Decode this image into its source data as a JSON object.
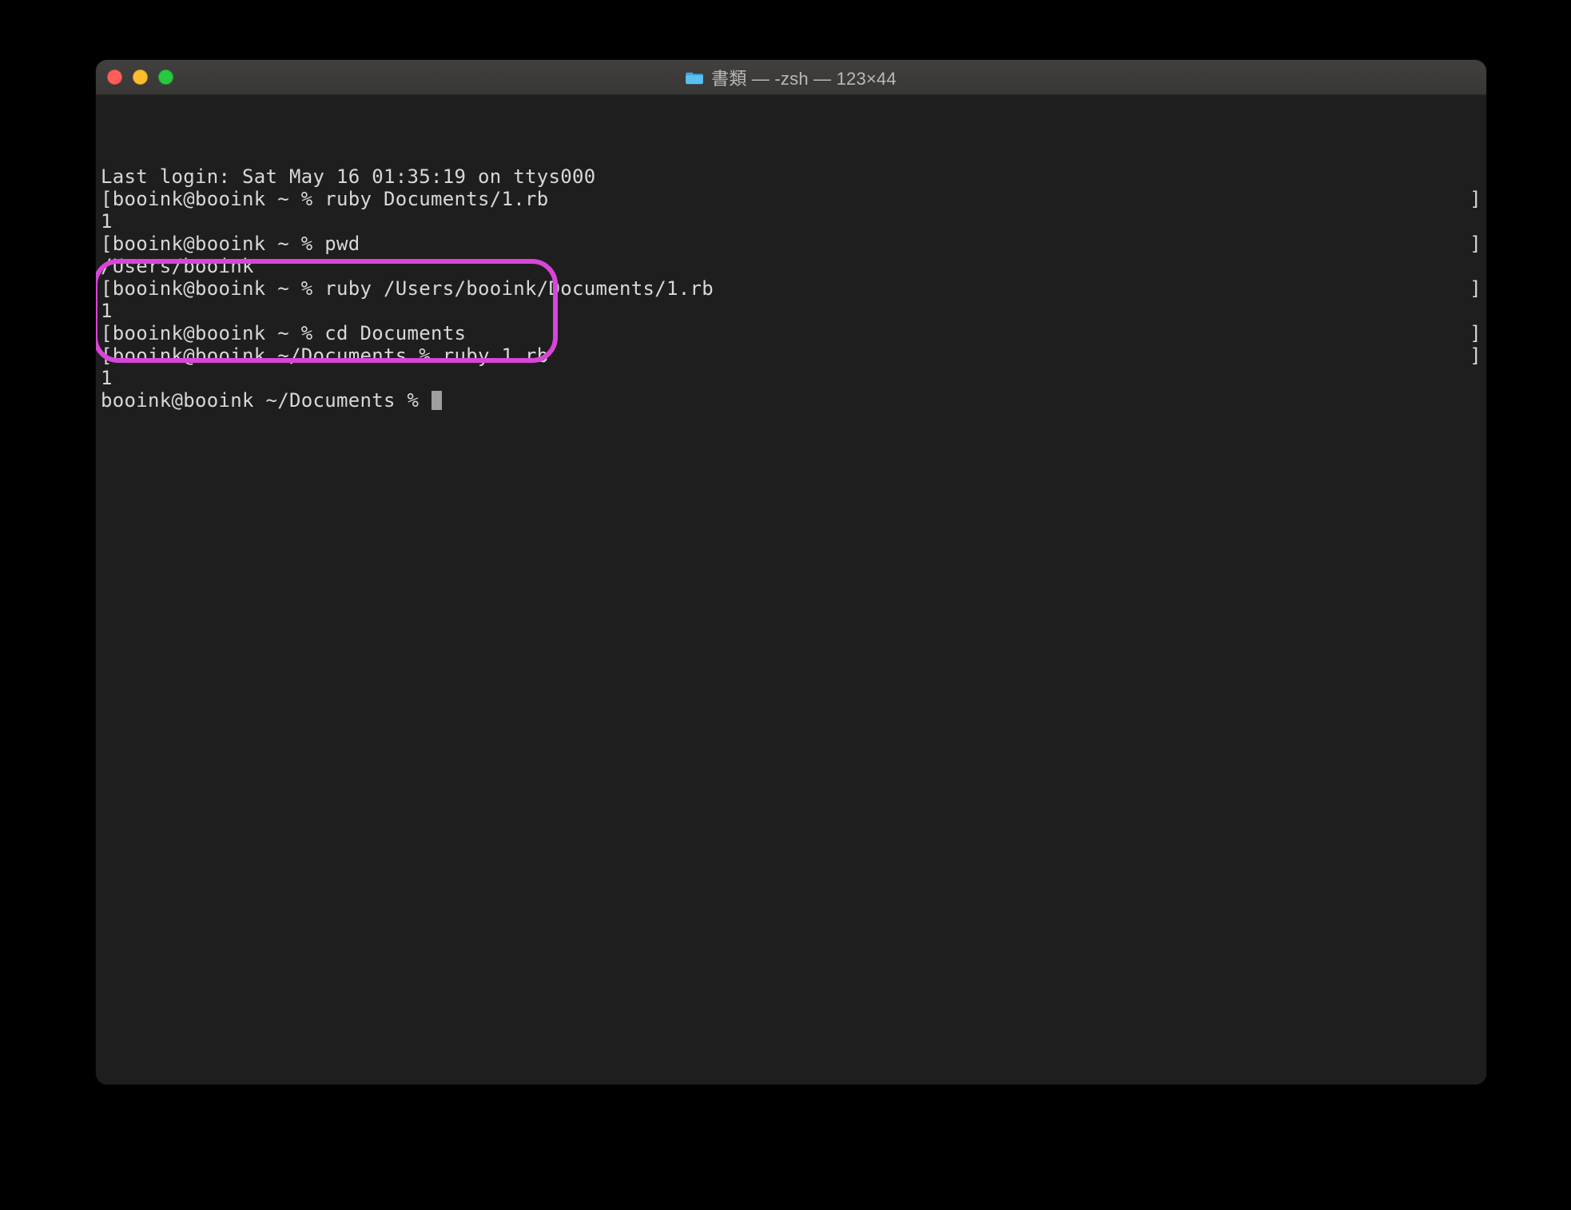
{
  "titlebar": {
    "title": "書類 — -zsh — 123×44",
    "folder_icon": "folder-icon"
  },
  "colors": {
    "highlight_border": "#d845d8",
    "terminal_bg": "#1e1e1e",
    "terminal_fg": "#d8d8d8",
    "titlebar_bg": "#3a3a3c",
    "traffic_red": "#ff5f57",
    "traffic_yellow": "#febc2e",
    "traffic_green": "#28c840"
  },
  "terminal": {
    "lines": [
      {
        "left": "Last login: Sat May 16 01:35:19 on ttys000",
        "right": ""
      },
      {
        "left": "[booink@booink ~ % ruby Documents/1.rb",
        "right": "]"
      },
      {
        "left": "1",
        "right": ""
      },
      {
        "left": "[booink@booink ~ % pwd",
        "right": "]"
      },
      {
        "left": "/Users/booink",
        "right": ""
      },
      {
        "left": "[booink@booink ~ % ruby /Users/booink/Documents/1.rb",
        "right": "]"
      },
      {
        "left": "1",
        "right": ""
      },
      {
        "left": "[booink@booink ~ % cd Documents",
        "right": "]"
      },
      {
        "left": "[booink@booink ~/Documents % ruby 1.rb",
        "right": "]"
      },
      {
        "left": "1",
        "right": ""
      },
      {
        "left": "booink@booink ~/Documents % ",
        "right": "",
        "cursor": true
      }
    ]
  },
  "annotation": {
    "highlight_rows_start": 7,
    "highlight_rows_end": 10
  }
}
